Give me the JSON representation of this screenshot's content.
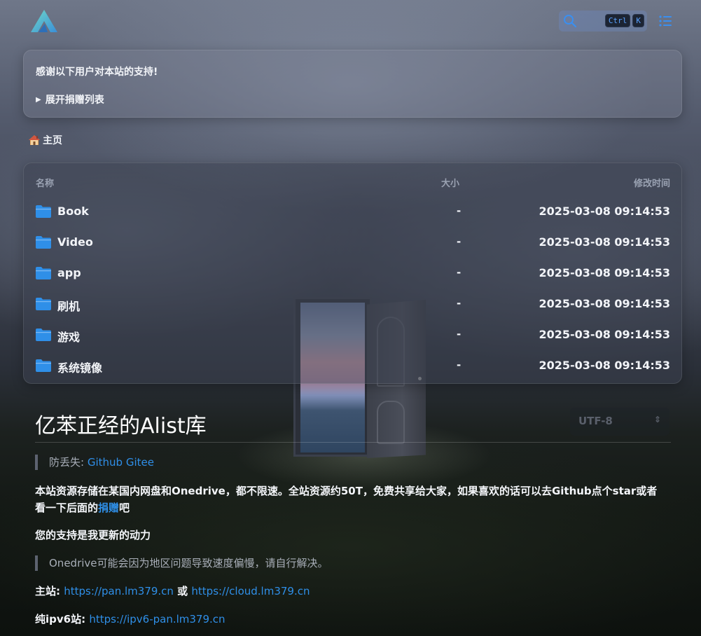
{
  "header": {
    "search_key_ctrl": "Ctrl",
    "search_key_k": "K"
  },
  "donate": {
    "title": "感谢以下用户对本站的支持!",
    "expand_label": "展开捐赠列表"
  },
  "breadcrumb": {
    "home_label": "主页"
  },
  "file_list": {
    "columns": {
      "name": "名称",
      "size": "大小",
      "modified": "修改时间"
    },
    "rows": [
      {
        "name": "Book",
        "size": "-",
        "modified": "2025-03-08 09:14:53"
      },
      {
        "name": "Video",
        "size": "-",
        "modified": "2025-03-08 09:14:53"
      },
      {
        "name": "app",
        "size": "-",
        "modified": "2025-03-08 09:14:53"
      },
      {
        "name": "刷机",
        "size": "-",
        "modified": "2025-03-08 09:14:53"
      },
      {
        "name": "游戏",
        "size": "-",
        "modified": "2025-03-08 09:14:53"
      },
      {
        "name": "系统镜像",
        "size": "-",
        "modified": "2025-03-08 09:14:53"
      }
    ]
  },
  "readme": {
    "title": "亿苯正经的Alist库",
    "encoding": "UTF-8",
    "quote1_prefix": "防丢失:",
    "quote1_link1": "Github",
    "quote1_link2": "Gitee",
    "para1": "本站资源存储在某国内网盘和Onedrive，都不限速。全站资源约50T，免费共享给大家，如果喜欢的话可以去Github点个star或者看一下后面的",
    "para1_link": "捐赠",
    "para1_suffix": "吧",
    "para2": "您的支持是我更新的动力",
    "quote2": "Onedrive可能会因为地区问题导致速度偏慢，请自行解决。",
    "main_site_label": "主站:",
    "main_site_link1": "https://pan.lm379.cn",
    "main_site_or": "或",
    "main_site_link2": "https://cloud.lm379.cn",
    "ipv6_label": "纯ipv6站:",
    "ipv6_link": "https://ipv6-pan.lm379.cn"
  },
  "colors": {
    "accent": "#2f8fe8",
    "folder": "#2f8fe8",
    "logo": "#5ec8c0"
  }
}
